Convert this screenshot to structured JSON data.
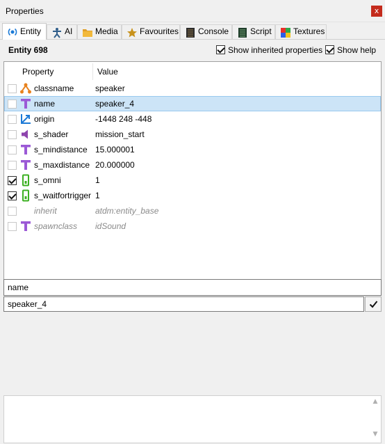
{
  "window": {
    "title": "Properties",
    "close_glyph": "x"
  },
  "tabs": [
    {
      "label": "Entity",
      "icon": "entity-icon",
      "active": true
    },
    {
      "label": "AI",
      "icon": "ai-icon"
    },
    {
      "label": "Media",
      "icon": "folder-icon"
    },
    {
      "label": "Favourites",
      "icon": "star-icon"
    },
    {
      "label": "Console",
      "icon": "console-icon"
    },
    {
      "label": "Script",
      "icon": "script-icon"
    },
    {
      "label": "Textures",
      "icon": "textures-icon"
    }
  ],
  "entity": {
    "title": "Entity 698",
    "show_inherited_label": "Show inherited properties",
    "show_inherited_checked": true,
    "show_help_label": "Show help",
    "show_help_checked": true
  },
  "table": {
    "col_property": "Property",
    "col_value": "Value",
    "rows": [
      {
        "name": "classname",
        "value": "speaker",
        "icon": "classname-icon",
        "checked": false,
        "selected": false,
        "inherited": false
      },
      {
        "name": "name",
        "value": "speaker_4",
        "icon": "text-icon",
        "checked": false,
        "selected": true,
        "inherited": false
      },
      {
        "name": "origin",
        "value": "-1448 248 -448",
        "icon": "vector-icon",
        "checked": false,
        "selected": false,
        "inherited": false
      },
      {
        "name": "s_shader",
        "value": "mission_start",
        "icon": "sound-icon",
        "checked": false,
        "selected": false,
        "inherited": false
      },
      {
        "name": "s_mindistance",
        "value": "15.000001",
        "icon": "text-icon",
        "checked": false,
        "selected": false,
        "inherited": false
      },
      {
        "name": "s_maxdistance",
        "value": "20.000000",
        "icon": "text-icon",
        "checked": false,
        "selected": false,
        "inherited": false
      },
      {
        "name": "s_omni",
        "value": "1",
        "icon": "boolean-icon",
        "checked": true,
        "selected": false,
        "inherited": false
      },
      {
        "name": "s_waitfortrigger",
        "value": "1",
        "icon": "boolean-icon",
        "checked": true,
        "selected": false,
        "inherited": false
      },
      {
        "name": "inherit",
        "value": "atdm:entity_base",
        "icon": "",
        "checked": false,
        "selected": false,
        "inherited": true
      },
      {
        "name": "spawnclass",
        "value": "idSound",
        "icon": "text-icon",
        "checked": false,
        "selected": false,
        "inherited": true
      }
    ]
  },
  "editor": {
    "key": "name",
    "value": "speaker_4"
  },
  "help": {
    "text": ""
  },
  "colors": {
    "selection": "#cce4f7",
    "text_icon": "#9b59d6",
    "classname_icon": "#e8821e",
    "vector_icon": "#1c7ad6",
    "sound_icon": "#8e44ad",
    "boolean_icon": "#3cb022"
  }
}
